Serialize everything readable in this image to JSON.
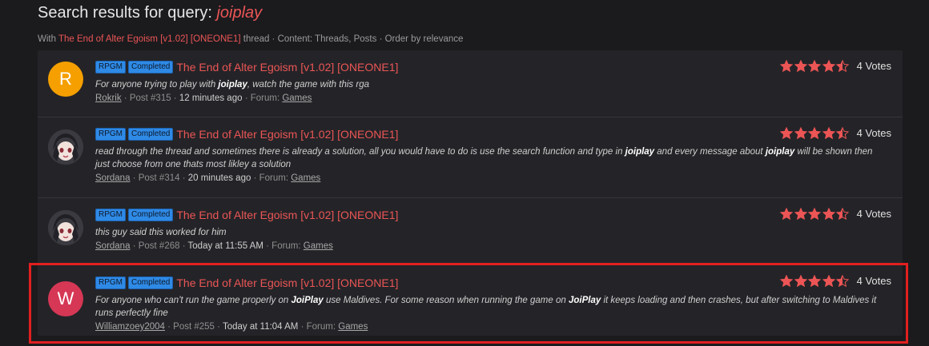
{
  "header": {
    "title_prefix": "Search results for query:",
    "query": "joiplay"
  },
  "filter": {
    "with": "With",
    "thread_link": "The End of Alter Egoism [v1.02] [ONEONE1]",
    "rest": "thread · Content: Threads, Posts · Order by relevance"
  },
  "colors": {
    "accent": "#ec5555",
    "badge": "#2f8ae6",
    "highlight": "#e21f1f",
    "avatar_r": "#f5a000",
    "avatar_w": "#d63755"
  },
  "results": [
    {
      "badges": [
        "RPGM",
        "Completed"
      ],
      "title": "The End of Alter Egoism [v1.02] [ONEONE1]",
      "snippet_pre": "For anyone trying to play with ",
      "snippet_bold": "joiplay",
      "snippet_post": ", watch the game with this rga",
      "user": "Rokrik",
      "post": "· Post #315 ·",
      "time": "12 minutes ago",
      "forum_label": "· Forum:",
      "forum": "Games",
      "rating": 4.5,
      "votes": "4 Votes",
      "avatar_letter": "R"
    },
    {
      "badges": [
        "RPGM",
        "Completed"
      ],
      "title": "The End of Alter Egoism [v1.02] [ONEONE1]",
      "snippet_a": "read through the thread and sometimes there is already a solution, all you would have to do is use the search function and type in ",
      "snippet_b": "joiplay",
      "snippet_c": " and every message about ",
      "snippet_d": "joiplay",
      "snippet_e": " will be shown then just choose from one thats most likley a solution",
      "user": "Sordana",
      "post": "· Post #314 ·",
      "time": "20 minutes ago",
      "forum_label": "· Forum:",
      "forum": "Games",
      "rating": 4.5,
      "votes": "4 Votes"
    },
    {
      "badges": [
        "RPGM",
        "Completed"
      ],
      "title": "The End of Alter Egoism [v1.02] [ONEONE1]",
      "snippet": "this guy said this worked for him",
      "user": "Sordana",
      "post": "· Post #268 ·",
      "time": "Today at 11:55 AM",
      "forum_label": "· Forum:",
      "forum": "Games",
      "rating": 4.5,
      "votes": "4 Votes"
    },
    {
      "badges": [
        "RPGM",
        "Completed"
      ],
      "title": "The End of Alter Egoism [v1.02] [ONEONE1]",
      "snippet_a": "For anyone who can't run the game properly on ",
      "snippet_b": "JoiPlay",
      "snippet_c": " use Maldives. For some reason when running the game on ",
      "snippet_d": "JoiPlay",
      "snippet_e": " it keeps loading and then crashes, but after switching to Maldives it runs perfectly fine",
      "user": "Williamzoey2004",
      "post": "· Post #255 ·",
      "time": "Today at 11:04 AM",
      "forum_label": "· Forum:",
      "forum": "Games",
      "rating": 4.5,
      "votes": "4 Votes",
      "avatar_letter": "W"
    }
  ]
}
